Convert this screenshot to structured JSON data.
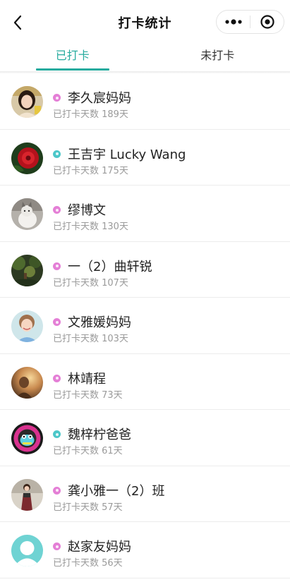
{
  "nav": {
    "title": "打卡统计",
    "back_icon": "chevron-left-icon",
    "more_icon": "more-dots-icon",
    "close_icon": "target-close-icon"
  },
  "tabs": [
    {
      "label": "已打卡",
      "active": true
    },
    {
      "label": "未打卡",
      "active": false
    }
  ],
  "colors": {
    "accent": "#26ab9e",
    "pink_dot": "#e47fd6",
    "teal_dot": "#4cc7c9",
    "subtext": "#9a9a9a"
  },
  "members": [
    {
      "name": "李久宸妈妈",
      "days": "已打卡天数 189天",
      "dot": "pink",
      "avatar": "girl-photo"
    },
    {
      "name": "王吉宇 Lucky Wang",
      "days": "已打卡天数 175天",
      "dot": "teal",
      "avatar": "red-flower-photo"
    },
    {
      "name": "缪博文",
      "days": "已打卡天数 130天",
      "dot": "pink",
      "avatar": "cat-photo"
    },
    {
      "name": "一（2）曲轩锐",
      "days": "已打卡天数 107天",
      "dot": "pink",
      "avatar": "forest-photo"
    },
    {
      "name": "文雅媛妈妈",
      "days": "已打卡天数 103天",
      "dot": "pink",
      "avatar": "child-photo"
    },
    {
      "name": "林靖程",
      "days": "已打卡天数 73天",
      "dot": "pink",
      "avatar": "sunset-photo"
    },
    {
      "name": "魏梓柠爸爸",
      "days": "已打卡天数 61天",
      "dot": "teal",
      "avatar": "cartoon-photo"
    },
    {
      "name": "龚小雅一（2）班",
      "days": "已打卡天数 57天",
      "dot": "pink",
      "avatar": "girl-standing-photo"
    },
    {
      "name": "赵家友妈妈",
      "days": "已打卡天数 56天",
      "dot": "pink",
      "avatar": "default-user-avatar"
    }
  ]
}
